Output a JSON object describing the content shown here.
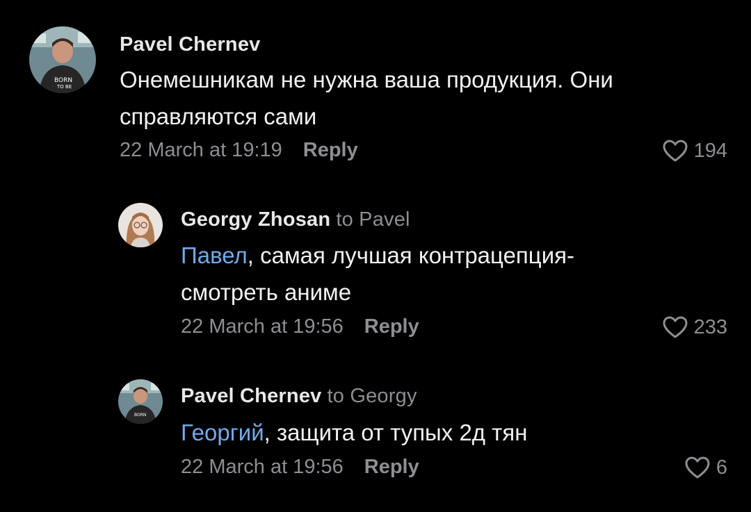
{
  "comments": [
    {
      "author": "Pavel Chernev",
      "to": "",
      "mention": "",
      "text": "Онемешникам не нужна ваша продукция. Они справляются сами",
      "date": "22 March at 19:19",
      "reply_label": "Reply",
      "likes": "194"
    },
    {
      "author": "Georgy Zhosan",
      "to": "to Pavel",
      "mention": "Павел",
      "text": ", самая лучшая контрацепция-смотреть аниме",
      "date": "22 March at 19:56",
      "reply_label": "Reply",
      "likes": "233"
    },
    {
      "author": "Pavel Chernev",
      "to": "to Georgy",
      "mention": "Георгий",
      "text": ", защита от тупых 2д тян",
      "date": "22 March at 19:56",
      "reply_label": "Reply",
      "likes": "6"
    }
  ],
  "colors": {
    "background": "#000000",
    "mention": "#71aaeb",
    "secondary_text": "#8e8e93",
    "primary_text": "#f2f2f2"
  },
  "icons": {
    "like": "heart-outline-icon"
  }
}
